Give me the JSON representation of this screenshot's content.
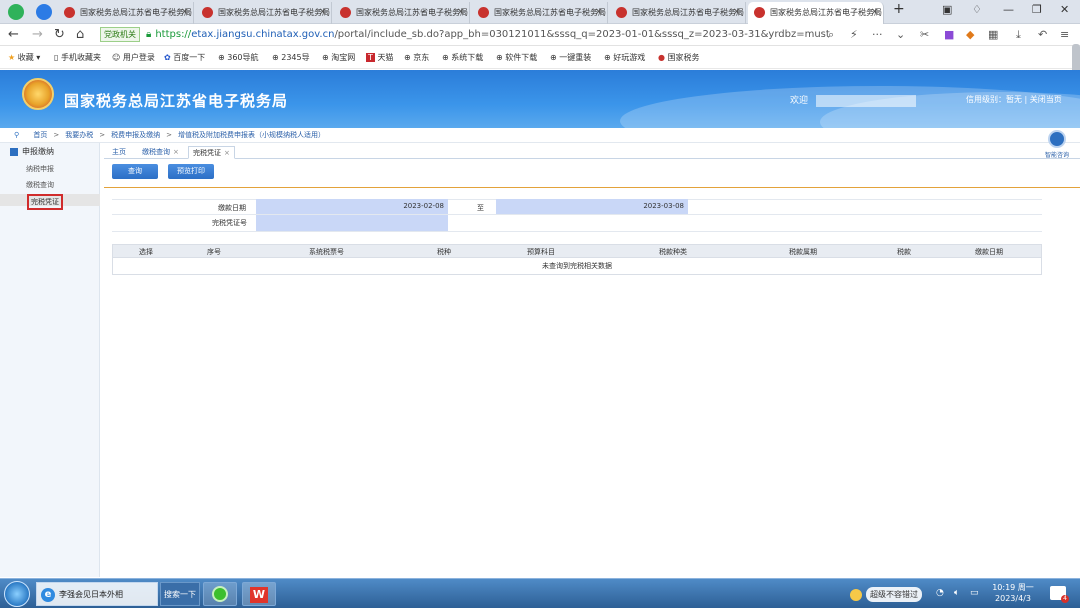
{
  "browser": {
    "tabs": [
      {
        "title": "国家税务总局江苏省电子税务局"
      },
      {
        "title": "国家税务总局江苏省电子税务局"
      },
      {
        "title": "国家税务总局江苏省电子税务局"
      },
      {
        "title": "国家税务总局江苏省电子税务局"
      },
      {
        "title": "国家税务总局江苏省电子税务局"
      },
      {
        "title": "国家税务总局江苏省电子税务局"
      }
    ],
    "new_tab": "+",
    "address": {
      "gov_badge": "党政机关",
      "scheme": "https://",
      "host": "etax.jiangsu.chinatax.gov.cn",
      "path": "/portal/include_sb.do?app_bh=030121011&sssq_q=2023-01-01&sssq_z=2023-03-31&yrdbz=must"
    },
    "bookmarks": [
      "收藏",
      "手机收藏夹",
      "用户登录",
      "百度一下",
      "360导航",
      "2345导",
      "淘宝网",
      "天猫",
      "京东",
      "系统下载",
      "软件下载",
      "一键重装",
      "好玩游戏",
      "国家税务"
    ]
  },
  "site": {
    "title": "国家税务总局江苏省电子税务局",
    "welcome": "欢迎",
    "credit": "信用级别：暂无",
    "separator": "|",
    "close": "关闭当页"
  },
  "breadcrumb": [
    "首页",
    "我要办税",
    "税费申报及缴纳",
    "增值税及附加税费申报表（小规模纳税人适用）"
  ],
  "sidebar": {
    "header": "申报缴纳",
    "items": [
      {
        "label": "纳税申报"
      },
      {
        "label": "缴税查询"
      },
      {
        "label": "完税凭证"
      }
    ]
  },
  "page_tabs": [
    {
      "label": "主页"
    },
    {
      "label": "缴税查询"
    },
    {
      "label": "完税凭证"
    }
  ],
  "buttons": {
    "query": "查询",
    "print_preview": "预览打印"
  },
  "form": {
    "pay_date_label": "缴款日期",
    "date_from": "2023-02-08",
    "to_label": "至",
    "date_to": "2023-03-08",
    "voucher_label": "完税凭证号",
    "voucher_value": ""
  },
  "table": {
    "columns": [
      "选择",
      "序号",
      "系统税票号",
      "税种",
      "预算科目",
      "税款种类",
      "税款属期",
      "税款",
      "缴款日期"
    ],
    "empty_message": "未查询到完税相关数据"
  },
  "help": {
    "label": "智能咨询"
  },
  "taskbar": {
    "ie_item": "李强会见日本外相",
    "search_button": "搜索一下",
    "ime": "超级不容错过",
    "clock_time": "10:19 周一",
    "clock_date": "2023/4/3",
    "notification_count": "4"
  }
}
